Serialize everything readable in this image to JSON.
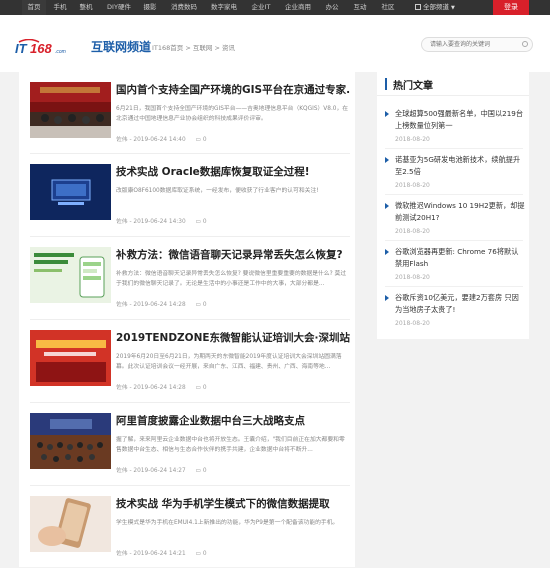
{
  "topnav": {
    "items": [
      "首页",
      "手机",
      "整机",
      "DIY硬件",
      "摄影",
      "消费数码",
      "数字家电",
      "企业IT",
      "企业商用",
      "办公",
      "互动",
      "社区"
    ],
    "portal": "全部频道",
    "login": "登录"
  },
  "header": {
    "logo_text": "IT168.com",
    "channel": "互联网频道",
    "breadcrumb": "IT168首页 > 互联网 > 资讯",
    "search_placeholder": "请输入要查询的关键词"
  },
  "articles": [
    {
      "title": "国内首个支持全国产环境的GIS平台在京通过专家...",
      "summary": "6月21日，我国首个支持全国产环境的GIS平台——吉奥地理信息平台（KQGIS）V8.0，在北京通过中国地理信息产业协会组织的科技成果评价评审。",
      "author": "佐伟",
      "date": "2019-06-24 14:40",
      "comments": "0"
    },
    {
      "title": "技术实战 Oracle数据库恢复取证全过程!",
      "summary": "改版康O8F6100数据库取证系统，一经发布，便收获了行业客户的认可和关注!",
      "author": "佐伟",
      "date": "2019-06-24 14:30",
      "comments": "0"
    },
    {
      "title": "补救方法：微信语音聊天记录异常丢失怎么恢复?",
      "summary": "补救方法：微信语音聊天记录异常丢失怎么恢复? 要说微信里重要重要的数据是什么? 莫过于我们的微信聊天记录了。无论是生活中的小事还是工作中的大事，大部分都是...",
      "author": "佐伟",
      "date": "2019-06-24 14:28",
      "comments": "0"
    },
    {
      "title": "2019TENDZONE东微智能认证培训大会·深圳站...",
      "summary": "2019年6月20日至6月21日，为期两天的东微智能2019年度认证培训大会深圳站圆满落幕。此次认证培训会议一经开展，来自广东、江西、福建、贵州、广西、海南等地...",
      "author": "佐伟",
      "date": "2019-06-24 14:28",
      "comments": "0"
    },
    {
      "title": "阿里首度披露企业数据中台三大战略支点",
      "summary": "握了解，来来阿里云企业数据中台也将开放生态。王囊介绍，\"我们目前正在加大都要和零售数据中台生态、相信与生态合作伙伴的携手共建，企业数据中台将不断升...",
      "author": "佐伟",
      "date": "2019-06-24 14:27",
      "comments": "0"
    },
    {
      "title": "技术实战 华为手机学生模式下的微信数据提取",
      "summary": "学生模式是华为手机在EMUI4.1上新推出的功能，华为P9是第一个配备该功能的手机。",
      "author": "佐伟",
      "date": "2019-06-24 14:21",
      "comments": "0"
    }
  ],
  "sidebar": {
    "title": "热门文章",
    "items": [
      {
        "title": "全球超算500强最新名单，中国以219台上榜数量位列第一",
        "date": "2018-08-20"
      },
      {
        "title": "诺基亚为5G研发电池新技术，续航提升至2.5倍",
        "date": "2018-08-20"
      },
      {
        "title": "微软推迟Windows 10 19H2更新，却提前测试20H1?",
        "date": "2018-08-20"
      },
      {
        "title": "谷歌浏览器再更新: Chrome 76将默认禁用Flash",
        "date": "2018-08-20"
      },
      {
        "title": "谷歌斥资10亿美元，要建2万套房 只因为当地房子太贵了!",
        "date": "2018-08-20"
      }
    ]
  },
  "colors": {
    "accent": "#1d5ea8",
    "login": "#d8202a",
    "topbar": "#333333"
  }
}
